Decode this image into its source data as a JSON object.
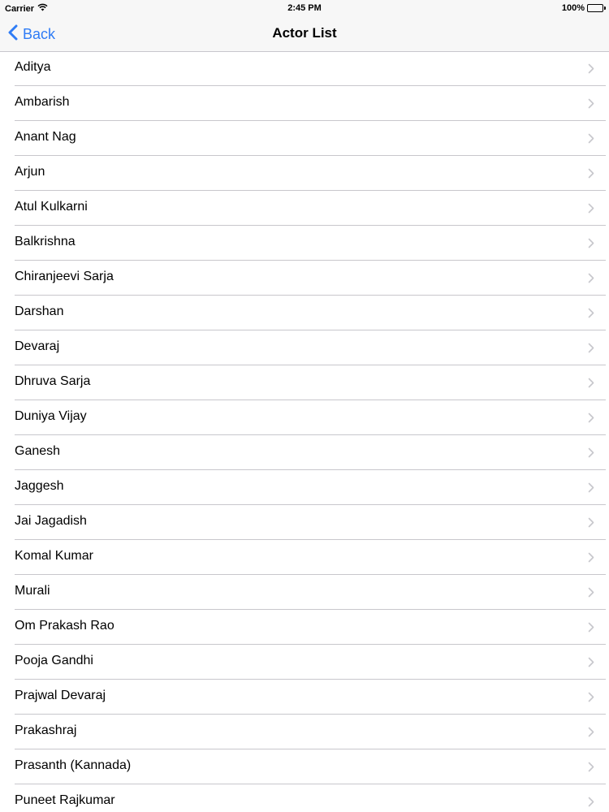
{
  "status_bar": {
    "carrier": "Carrier",
    "time": "2:45 PM",
    "battery": "100%",
    "wifi_icon": "wifi-icon",
    "battery_icon": "battery-full-icon"
  },
  "nav": {
    "back_label": "Back",
    "back_icon": "chevron-left-icon",
    "title": "Actor List"
  },
  "colors": {
    "accent": "#2f7cf6",
    "separator": "#c8c7cc",
    "chevron": "#c7c7cc",
    "bar_background": "#f7f7f7"
  },
  "actors": [
    "Aditya",
    "Ambarish",
    "Anant Nag",
    "Arjun",
    "Atul Kulkarni",
    "Balkrishna",
    "Chiranjeevi Sarja",
    "Darshan",
    "Devaraj",
    "Dhruva Sarja",
    "Duniya Vijay",
    "Ganesh",
    "Jaggesh",
    "Jai Jagadish",
    "Komal Kumar",
    "Murali",
    "Om Prakash Rao",
    "Pooja Gandhi",
    "Prajwal Devaraj",
    "Prakashraj",
    "Prasanth (Kannada)",
    "Puneet Rajkumar"
  ]
}
